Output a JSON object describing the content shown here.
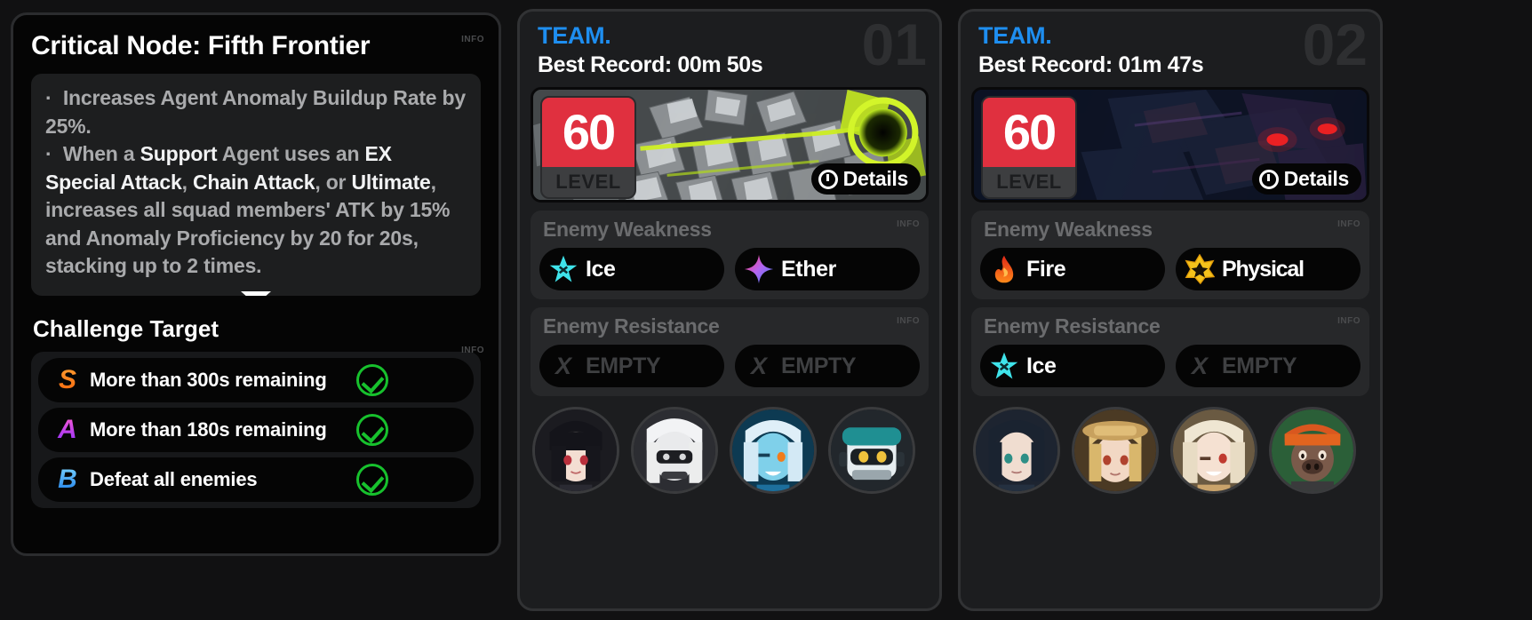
{
  "left": {
    "node_title": "Critical Node: Fifth Frontier",
    "info_label": "INFO",
    "description_html": "&middot;&nbsp; Increases Agent Anomaly Buildup Rate by 25%.<br>&middot;&nbsp; When a <b>Support</b> Agent uses an <b>EX Special Attack</b>, <b>Chain Attack</b>, or <b>Ultimate</b>, increases all squad members' ATK by 15% and Anomaly Proficiency by 20 for 20s, stacking up to 2 times.",
    "challenge_title": "Challenge Target",
    "challenge_info_label": "INFO",
    "targets": [
      {
        "rank": "S",
        "rank_class": "s",
        "text": "More than 300s remaining",
        "completed": true
      },
      {
        "rank": "A",
        "rank_class": "a",
        "text": "More than 180s remaining",
        "completed": true
      },
      {
        "rank": "B",
        "rank_class": "b",
        "text": "Defeat all enemies",
        "completed": true
      }
    ]
  },
  "teams": [
    {
      "label": "TEAM.",
      "record": "Best Record: 00m 50s",
      "number": "01",
      "level_value": "60",
      "level_caption": "LEVEL",
      "details_label": "Details",
      "banner_style": "a1",
      "weakness": {
        "title": "Enemy Weakness",
        "info_label": "INFO",
        "items": [
          {
            "name": "Ice",
            "icon": "ice-icon",
            "color": "#36e0e8",
            "empty": false
          },
          {
            "name": "Ether",
            "icon": "ether-icon",
            "color": "#b06cf0",
            "empty": false
          }
        ]
      },
      "resistance": {
        "title": "Enemy Resistance",
        "info_label": "INFO",
        "items": [
          {
            "name": "EMPTY",
            "icon": "x-icon",
            "color": "#3b3c3e",
            "empty": true
          },
          {
            "name": "EMPTY",
            "icon": "x-icon",
            "color": "#3b3c3e",
            "empty": true
          }
        ]
      },
      "agents": [
        {
          "name": "agent-1",
          "hair": "#1b1b20",
          "skin": "#f3ded2",
          "accent": "#b9303c"
        },
        {
          "name": "agent-2",
          "hair": "#e9eaec",
          "skin": "#dfe1e4",
          "accent": "#3a3b40"
        },
        {
          "name": "agent-3",
          "hair": "#cfe6f5",
          "skin": "#6fc6e8",
          "accent": "#1d6f9c"
        },
        {
          "name": "agent-4",
          "hair": "#2a3238",
          "skin": "#dbe3e6",
          "accent": "#1f8f92"
        }
      ]
    },
    {
      "label": "TEAM.",
      "record": "Best Record: 01m 47s",
      "number": "02",
      "level_value": "60",
      "level_caption": "LEVEL",
      "details_label": "Details",
      "banner_style": "a2",
      "weakness": {
        "title": "Enemy Weakness",
        "info_label": "INFO",
        "items": [
          {
            "name": "Fire",
            "icon": "fire-icon",
            "color": "#f04a1c",
            "empty": false
          },
          {
            "name": "Physical",
            "icon": "physical-icon",
            "color": "#f5c21b",
            "empty": false
          }
        ]
      },
      "resistance": {
        "title": "Enemy Resistance",
        "info_label": "INFO",
        "items": [
          {
            "name": "Ice",
            "icon": "ice-icon",
            "color": "#36e0e8",
            "empty": false
          },
          {
            "name": "EMPTY",
            "icon": "x-icon",
            "color": "#3b3c3e",
            "empty": true
          }
        ]
      },
      "agents": [
        {
          "name": "agent-1",
          "hair": "#1d2430",
          "skin": "#f0ddd0",
          "accent": "#2e8f86"
        },
        {
          "name": "agent-2",
          "hair": "#e2c27a",
          "skin": "#f2d8c4",
          "accent": "#8a6a3e"
        },
        {
          "name": "agent-3",
          "hair": "#efe6d2",
          "skin": "#f5e1d2",
          "accent": "#c9a36b"
        },
        {
          "name": "agent-4",
          "hair": "#d9571f",
          "skin": "#7a5a4a",
          "accent": "#2b5f38"
        }
      ]
    }
  ]
}
